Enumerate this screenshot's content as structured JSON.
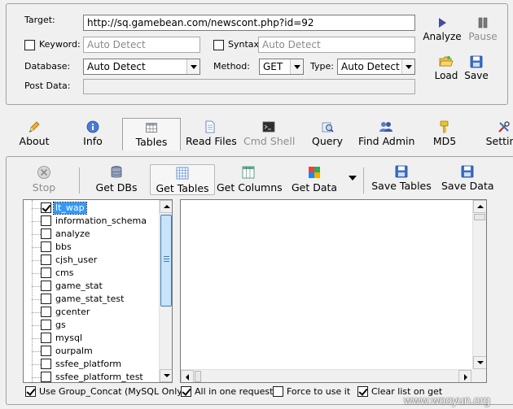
{
  "form": {
    "target_label": "Target:",
    "target_value": "http://sq.gamebean.com/newscont.php?id=92",
    "keyword_label": "Keyword:",
    "keyword_placeholder": "Auto Detect",
    "syntax_label": "Syntax:",
    "syntax_placeholder": "Auto Detect",
    "database_label": "Database:",
    "database_value": "Auto Detect",
    "method_label": "Method:",
    "method_value": "GET",
    "type_label": "Type:",
    "type_value": "Auto Detect",
    "postdata_label": "Post Data:"
  },
  "actions": {
    "analyze": "Analyze",
    "pause": "Pause",
    "load": "Load",
    "save": "Save"
  },
  "tabs": [
    {
      "label": "About"
    },
    {
      "label": "Info"
    },
    {
      "label": "Tables"
    },
    {
      "label": "Read Files"
    },
    {
      "label": "Cmd Shell"
    },
    {
      "label": "Query"
    },
    {
      "label": "Find Admin"
    },
    {
      "label": "MD5"
    },
    {
      "label": "Setting"
    }
  ],
  "toolbar": {
    "stop": "Stop",
    "get_dbs": "Get DBs",
    "get_tables": "Get Tables",
    "get_columns": "Get Columns",
    "get_data": "Get Data",
    "save_tables": "Save Tables",
    "save_data": "Save Data"
  },
  "databases": [
    "lt_wap",
    "information_schema",
    "analyze",
    "bbs",
    "cjsh_user",
    "cms",
    "game_stat",
    "game_stat_test",
    "gcenter",
    "gs",
    "mysql",
    "ourpalm",
    "ssfee_platform",
    "ssfee_platform_test"
  ],
  "options": {
    "group_concat": "Use Group_Concat (MySQL Only)",
    "all_in_one": "All in one request.",
    "force": "Force to use it",
    "clear_list": "Clear list on get"
  },
  "watermark": "www.wooyun.org"
}
